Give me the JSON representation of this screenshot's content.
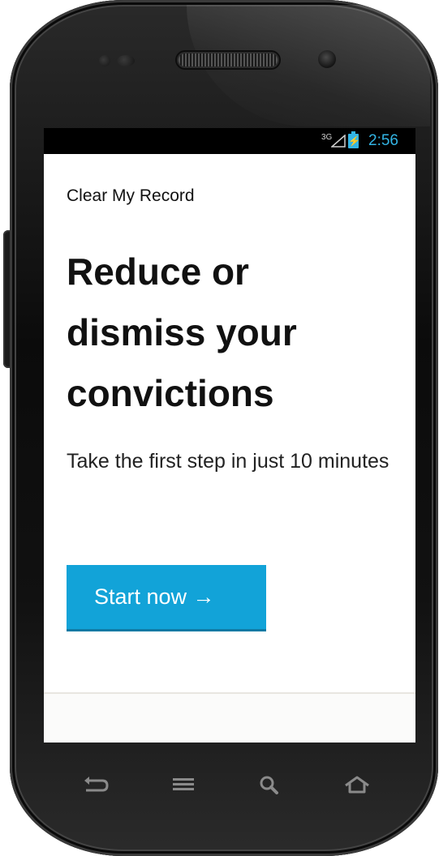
{
  "status_bar": {
    "network": "3G",
    "time": "2:56",
    "battery_icon": "battery-charging-icon",
    "signal_icon": "signal-icon"
  },
  "app": {
    "title": "Clear My Record",
    "headline": "Reduce or dismiss your convictions",
    "subtext": "Take the first step in just 10 minutes",
    "cta_label": "Start now →"
  },
  "nav_bar": {
    "buttons": [
      "back-icon",
      "menu-icon",
      "search-icon",
      "home-icon"
    ]
  },
  "colors": {
    "accent": "#12a3d8",
    "status": "#33b5e5",
    "text": "#111111"
  }
}
